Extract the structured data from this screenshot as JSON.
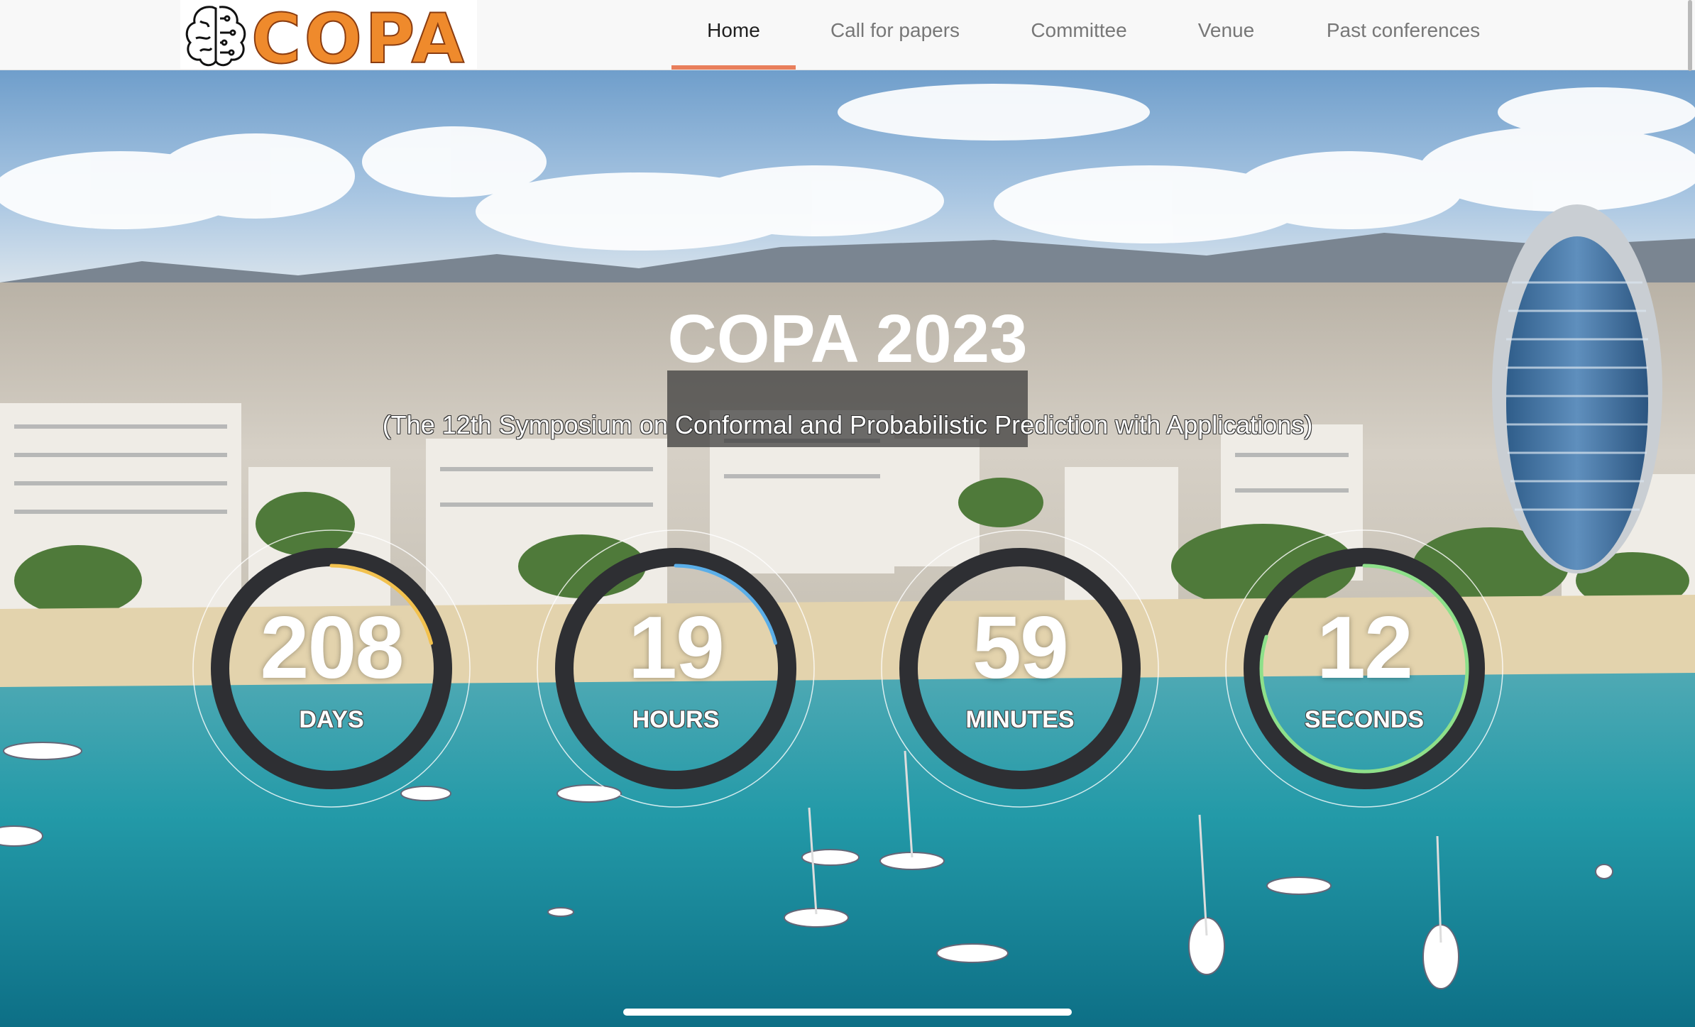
{
  "brand": {
    "logo_text": "COPA",
    "logo_icon": "brain-icon"
  },
  "nav": {
    "items": [
      {
        "label": "Home",
        "active": true
      },
      {
        "label": "Call for papers",
        "active": false
      },
      {
        "label": "Committee",
        "active": false
      },
      {
        "label": "Venue",
        "active": false
      },
      {
        "label": "Past conferences",
        "active": false
      }
    ]
  },
  "hero": {
    "title": "COPA 2023",
    "subtitle": "(The 12th Symposium on Conformal and Probabilistic Prediction with Applications)"
  },
  "countdown": [
    {
      "value": "208",
      "unit": "DAYS",
      "progress": 0.21,
      "color": "#f2c14e"
    },
    {
      "value": "19",
      "unit": "HOURS",
      "progress": 0.21,
      "color": "#5aaee8"
    },
    {
      "value": "59",
      "unit": "MINUTES",
      "progress": 0.0,
      "color": "#e8e8e8"
    },
    {
      "value": "12",
      "unit": "SECONDS",
      "progress": 0.8,
      "color": "#8ee08a"
    }
  ],
  "colors": {
    "accent": "#e97f5c",
    "logo_orange": "#ef8a2c"
  }
}
